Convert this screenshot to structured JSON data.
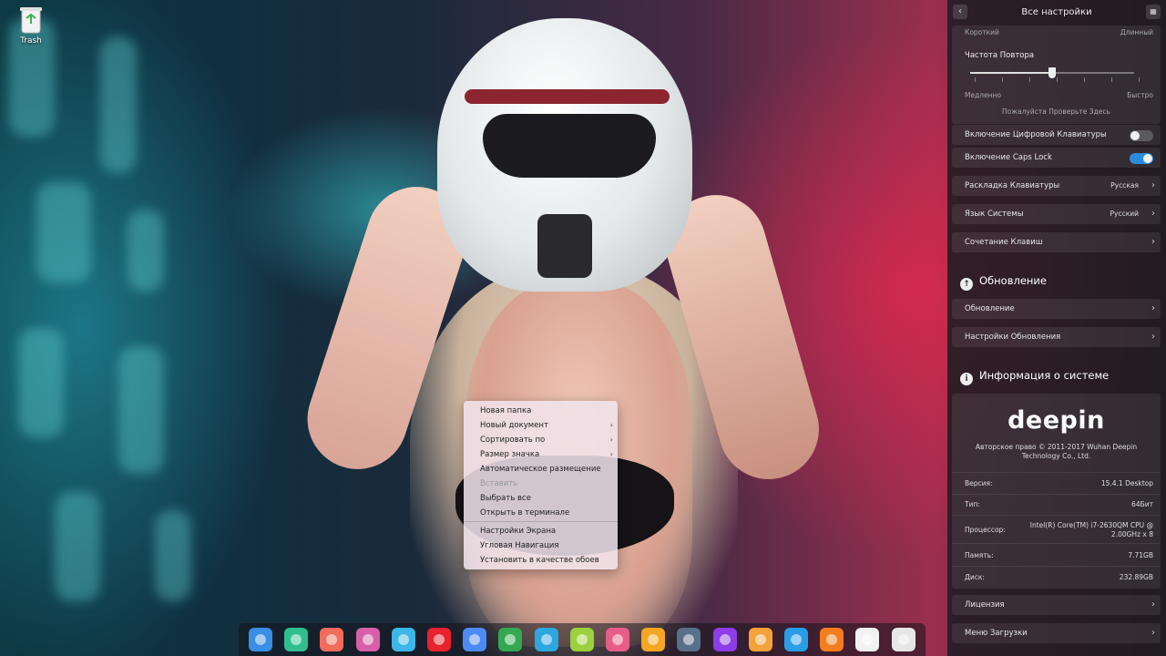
{
  "desktop": {
    "trash_label": "Trash"
  },
  "context_menu": {
    "items": [
      {
        "label": "Новая папка",
        "submenu": false,
        "disabled": false
      },
      {
        "label": "Новый документ",
        "submenu": true,
        "disabled": false
      },
      {
        "label": "Сортировать по",
        "submenu": true,
        "disabled": false
      },
      {
        "label": "Размер значка",
        "submenu": true,
        "disabled": false
      },
      {
        "label": "Автоматическое размещение",
        "submenu": false,
        "disabled": false
      },
      {
        "label": "Вставить",
        "submenu": false,
        "disabled": true
      },
      {
        "label": "Выбрать все",
        "submenu": false,
        "disabled": false
      },
      {
        "label": "Открыть в терминале",
        "submenu": false,
        "disabled": false
      },
      {
        "label": "Настройки Экрана",
        "submenu": false,
        "disabled": false
      },
      {
        "label": "Угловая Навигация",
        "submenu": false,
        "disabled": false
      },
      {
        "label": "Установить в качестве обоев",
        "submenu": false,
        "disabled": false
      }
    ]
  },
  "settings": {
    "title": "Все настройки",
    "delay": {
      "short": "Короткий",
      "long": "Длинный"
    },
    "repeat": {
      "label": "Частота Повтора",
      "slow": "Медленно",
      "fast": "Быстро",
      "test_hint": "Пожалуйста Проверьте Здесь",
      "value": 0.5
    },
    "numlock": {
      "label": "Включение Цифровой Клавиатуры",
      "on": false
    },
    "capslock": {
      "label": "Включение Caps Lock",
      "on": true
    },
    "layout": {
      "label": "Раскладка Клавиатуры",
      "value": "Русская"
    },
    "language": {
      "label": "Язык Системы",
      "value": "Русский"
    },
    "shortcuts": {
      "label": "Сочетание Клавиш"
    },
    "update_section": {
      "title": "Обновление",
      "items": [
        "Обновление",
        "Настройки Обновления"
      ]
    },
    "sysinfo": {
      "title": "Информация о системе",
      "logo": "deepin",
      "copyright": "Авторское право © 2011-2017 Wuhan Deepin Technology Co., Ltd.",
      "rows": [
        {
          "key": "Версия:",
          "value": "15.4.1 Desktop"
        },
        {
          "key": "Тип:",
          "value": "64Бит"
        },
        {
          "key": "Процессор:",
          "value": "Intel(R) Core(TM) i7-2630QM CPU @ 2.00GHz x 8"
        },
        {
          "key": "Память:",
          "value": "7.71GB"
        },
        {
          "key": "Диск:",
          "value": "232.89GB"
        }
      ],
      "license": "Лицензия",
      "boot_menu": "Меню Загрузки"
    }
  },
  "dock": {
    "icons": [
      {
        "name": "launcher-icon",
        "color": "#3a8ee6"
      },
      {
        "name": "file-manager-icon",
        "color": "#2fbf8f"
      },
      {
        "name": "screen-recorder-icon",
        "color": "#f26b5b"
      },
      {
        "name": "control-center-icon",
        "color": "#d65fa8"
      },
      {
        "name": "app-store-icon",
        "color": "#3db6e8"
      },
      {
        "name": "opera-icon",
        "color": "#e8222e"
      },
      {
        "name": "chromium-icon",
        "color": "#4c8bf5"
      },
      {
        "name": "chrome-icon",
        "color": "#34a853"
      },
      {
        "name": "telegram-icon",
        "color": "#2ea6de"
      },
      {
        "name": "music-icon",
        "color": "#9bd13e"
      },
      {
        "name": "pen-tool-icon",
        "color": "#e85c8a"
      },
      {
        "name": "image-viewer-icon",
        "color": "#f5a623"
      },
      {
        "name": "screenshot-icon",
        "color": "#5a6f8a"
      },
      {
        "name": "shutdown-icon",
        "color": "#8e3de8"
      },
      {
        "name": "theme-icon",
        "color": "#f5a23a"
      },
      {
        "name": "wifi-icon",
        "color": "#2a9de8"
      },
      {
        "name": "upload-icon",
        "color": "#f57c1f"
      },
      {
        "name": "clock-icon",
        "color": "#f2f2f2"
      },
      {
        "name": "trash-icon",
        "color": "#e6e6e6"
      }
    ]
  }
}
